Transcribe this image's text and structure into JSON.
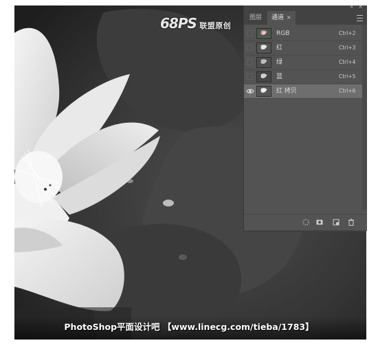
{
  "watermark": {
    "logo_mark": "68PS",
    "logo_text": "联盟原创"
  },
  "footer": {
    "text": "PhotoShop平面设计吧 【www.linecg.com/tieba/1783】"
  },
  "panel": {
    "tabs": [
      {
        "label": "图层",
        "active": false
      },
      {
        "label": "通道",
        "active": true,
        "close": "×"
      }
    ],
    "topbar": {
      "collapse": "«",
      "close": "×"
    },
    "channels": [
      {
        "name": "RGB",
        "shortcut": "Ctrl+2",
        "visible": false,
        "selected": false,
        "thumb": "color"
      },
      {
        "name": "红",
        "shortcut": "Ctrl+3",
        "visible": false,
        "selected": false,
        "thumb": "gray"
      },
      {
        "name": "绿",
        "shortcut": "Ctrl+4",
        "visible": false,
        "selected": false,
        "thumb": "gray"
      },
      {
        "name": "蓝",
        "shortcut": "Ctrl+5",
        "visible": false,
        "selected": false,
        "thumb": "gray"
      },
      {
        "name": "红 拷贝",
        "shortcut": "Ctrl+6",
        "visible": true,
        "selected": true,
        "thumb": "gray"
      }
    ],
    "bottom_icons": [
      "load-selection-icon",
      "save-selection-as-channel-icon",
      "new-channel-icon",
      "delete-channel-icon"
    ]
  },
  "colors": {
    "panel_bg": "#535353",
    "panel_dark": "#424242",
    "selected_row": "#6e6e6e",
    "canvas_bg": "#2f2f2f"
  }
}
